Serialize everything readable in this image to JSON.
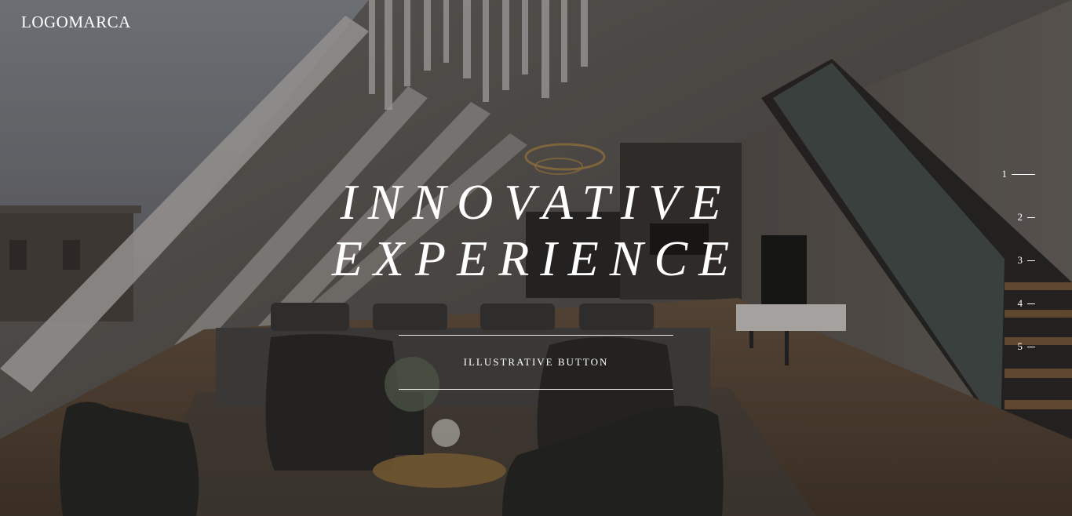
{
  "header": {
    "logo_text": "LOGOMARCA"
  },
  "hero": {
    "headline_line1": "INNOVATIVE",
    "headline_line2": "EXPERIENCE",
    "cta_label": "ILLUSTRATIVE BUTTON"
  },
  "slide_nav": {
    "active_index": 1,
    "items": [
      {
        "label": "1"
      },
      {
        "label": "2"
      },
      {
        "label": "3"
      },
      {
        "label": "4"
      },
      {
        "label": "5"
      }
    ]
  }
}
